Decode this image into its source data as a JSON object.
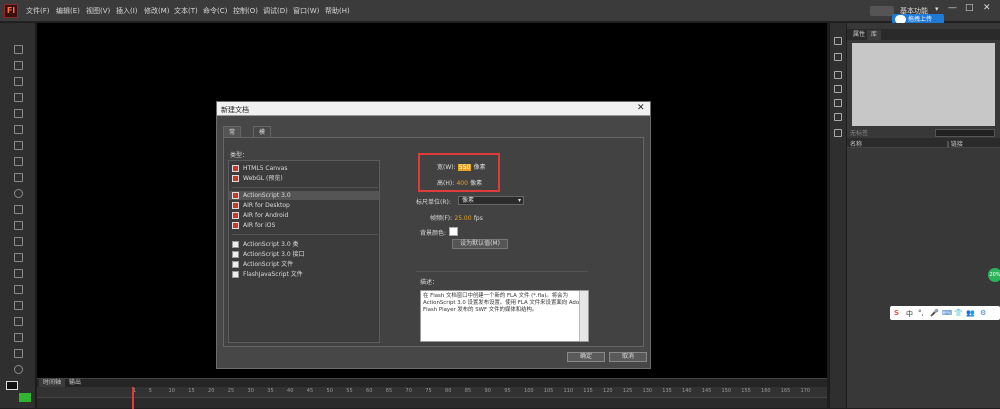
{
  "app": {
    "logo": "Fl"
  },
  "menu": [
    "文件(F)",
    "编辑(E)",
    "视图(V)",
    "插入(I)",
    "修改(M)",
    "文本(T)",
    "命令(C)",
    "控制(O)",
    "调试(D)",
    "窗口(W)",
    "帮助(H)"
  ],
  "workspace": {
    "label": "基本功能",
    "caret": "▾"
  },
  "window_controls": {
    "minimize": "—",
    "maximize": "□",
    "close": "✕"
  },
  "cloud": {
    "label": "拖拽上传"
  },
  "right_panel": {
    "tabs": [
      "属性",
      "库"
    ],
    "search_label": "无标签",
    "col_name": "名称",
    "col_link": "| 链接"
  },
  "timeline": {
    "tabs": [
      "时间轴",
      "输出"
    ],
    "frames": [
      1,
      5,
      10,
      15,
      20,
      25,
      30,
      35,
      40,
      45,
      50,
      55,
      60,
      65,
      70,
      75,
      80,
      85,
      90,
      95,
      100,
      105,
      110,
      115,
      120,
      125,
      130,
      135,
      140,
      145,
      150,
      155,
      160,
      165,
      170
    ]
  },
  "green_badge": "20%",
  "ime_icons": [
    "S",
    "中",
    "°,",
    "🎤",
    "⌨",
    "👕",
    "👥",
    "⚙"
  ],
  "dialog": {
    "title": "新建文档",
    "close": "✕",
    "tabs": [
      "常规",
      "模板"
    ],
    "type_label": "类型：",
    "types": [
      {
        "label": "HTML5 Canvas",
        "icon": "red"
      },
      {
        "label": "WebGL (预览)",
        "icon": "red"
      },
      {
        "label": "ActionScript 3.0",
        "icon": "red",
        "selected": true
      },
      {
        "label": "AIR for Desktop",
        "icon": "red"
      },
      {
        "label": "AIR for Android",
        "icon": "red"
      },
      {
        "label": "AIR for iOS",
        "icon": "red"
      },
      {
        "label": "ActionScript 3.0 类",
        "icon": "white"
      },
      {
        "label": "ActionScript 3.0 接口",
        "icon": "white"
      },
      {
        "label": "ActionScript 文件",
        "icon": "white"
      },
      {
        "label": "FlashJavaScript 文件",
        "icon": "white"
      }
    ],
    "width_label": "宽(W):",
    "width_value": "550",
    "width_unit": "像素",
    "height_label": "高(H):",
    "height_value": "400",
    "height_unit": "像素",
    "ruler_label": "标尺单位(R):",
    "ruler_value": "像素",
    "fps_label": "帧频(F):",
    "fps_value": "25.00",
    "fps_unit": "fps",
    "bg_label": "背景颜色:",
    "bg_color": "#ffffff",
    "default_button": "设为默认值(M)",
    "desc_label": "描述：",
    "description": "在 Flash 文档窗口中创建一个新的 FLA 文件 (*.fla)。将会为 ActionScript 3.0 设置发布设置。使用 FLA 文件来设置面向 Adobe Flash Player 发布的 SWF 文件的媒体和结构。",
    "ok": "确定",
    "cancel": "取消"
  }
}
